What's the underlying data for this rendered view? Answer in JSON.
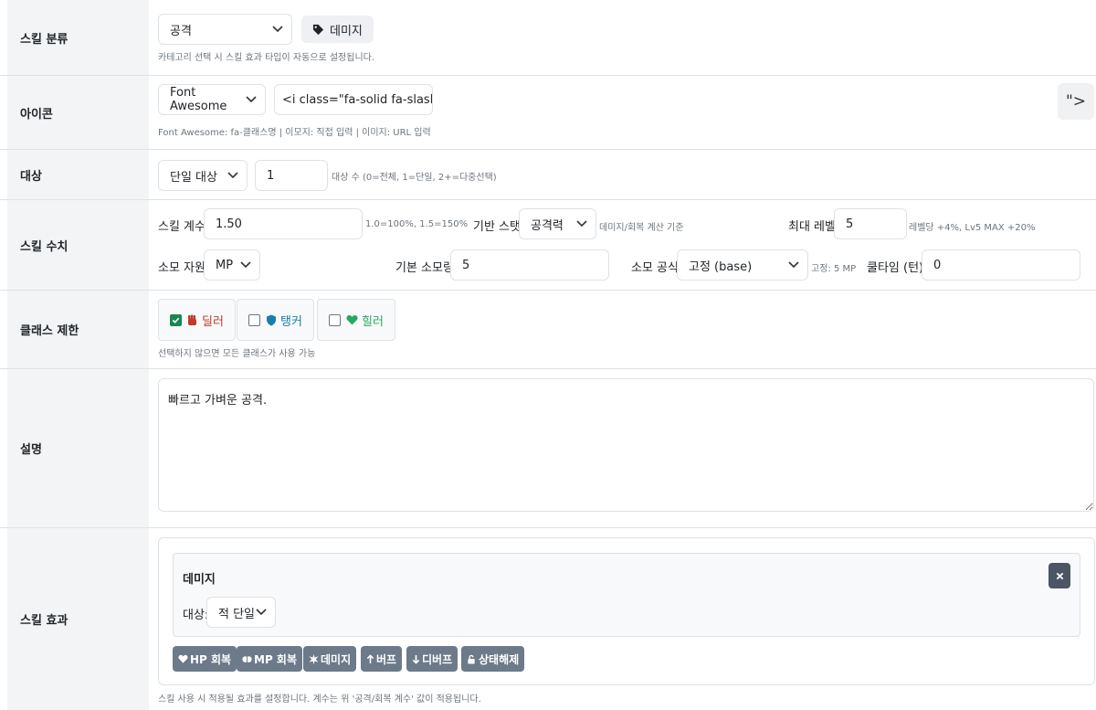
{
  "skill_category": {
    "label": "스킬 분류",
    "selected": "공격",
    "tag_label": "데미지",
    "help": "카테고리 선택 시 스킬 효과 타입이 자동으로 설정됩니다."
  },
  "icon": {
    "label": "아이콘",
    "type_selected": "Font Awesome",
    "value": "<i class=\"fa-solid fa-slash\"><",
    "code_button": "\">",
    "help": "Font Awesome: fa-클래스명 | 이모지: 직접 입력 | 이미지: URL 입력"
  },
  "target": {
    "label": "대상",
    "selected": "단일 대상",
    "count": "1",
    "help": "대상 수 (0=전체, 1=단일, 2+=다중선택)"
  },
  "values": {
    "label": "스킬 수치",
    "coef_label": "스킬 계수",
    "coef_value": "1.50",
    "coef_help": "1.0=100%, 1.5=150%",
    "stat_label": "기반 스탯",
    "stat_selected": "공격력",
    "stat_help": "데미지/회복 계산 기준",
    "maxlv_label": "최대 레벨",
    "maxlv_value": "5",
    "maxlv_help": "레벨당 +4%, Lv5 MAX +20%",
    "resource_label": "소모 자원",
    "resource_selected": "MP",
    "cost_label": "기본 소모량",
    "cost_value": "5",
    "formula_label": "소모 공식",
    "formula_selected": "고정 (base)",
    "formula_help": "고정: 5 MP",
    "cooldown_label": "쿨타임 (턴)",
    "cooldown_value": "0"
  },
  "class_limit": {
    "label": "클래스 제한",
    "options": [
      {
        "label": "딜러",
        "checked": true,
        "color": "#c0392b",
        "icon": "fist-icon"
      },
      {
        "label": "탱커",
        "checked": false,
        "color": "#1a7fa8",
        "icon": "shield-icon"
      },
      {
        "label": "힐러",
        "checked": false,
        "color": "#27a862",
        "icon": "heart-icon"
      }
    ],
    "help": "선택하지 않으면 모든 클래스가 사용 가능"
  },
  "description": {
    "label": "설명",
    "value": "빠르고 가벼운 공격."
  },
  "effects": {
    "label": "스킬 효과",
    "card_title": "데미지",
    "target_label": "대상:",
    "target_selected": "적 단일",
    "buttons": [
      "HP 회복",
      "MP 회복",
      "데미지",
      "버프",
      "디버프",
      "상태해제"
    ],
    "help": "스킬 사용 시 적용될 효과를 설정합니다. 계수는 위 '공격/회복 계수' 값이 적용됩니다."
  }
}
